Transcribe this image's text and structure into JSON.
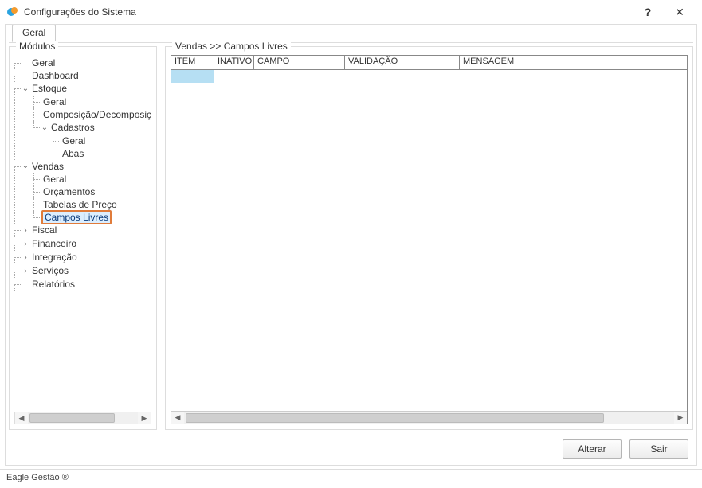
{
  "window": {
    "title": "Configurações do Sistema",
    "help_hint": "?",
    "close_hint": "✕"
  },
  "tabs": {
    "geral": "Geral"
  },
  "sidebar": {
    "legend": "Módulos",
    "items": {
      "geral": "Geral",
      "dashboard": "Dashboard",
      "estoque": "Estoque",
      "estoque_geral": "Geral",
      "estoque_comp": "Composição/Decomposição",
      "estoque_cadastros": "Cadastros",
      "cadastros_geral": "Geral",
      "cadastros_abas": "Abas",
      "vendas": "Vendas",
      "vendas_geral": "Geral",
      "vendas_orcamentos": "Orçamentos",
      "vendas_tabelas": "Tabelas de Preço",
      "vendas_campos_livres": "Campos Livres",
      "fiscal": "Fiscal",
      "financeiro": "Financeiro",
      "integracao": "Integração",
      "servicos": "Serviços",
      "relatorios": "Relatórios"
    }
  },
  "content": {
    "breadcrumb": "Vendas >> Campos Livres",
    "columns": {
      "item": "ITEM",
      "inativo": "INATIVO",
      "campo": "CAMPO",
      "validacao": "VALIDAÇÃO",
      "mensagem": "MENSAGEM"
    }
  },
  "buttons": {
    "alterar": "Alterar",
    "sair": "Sair"
  },
  "status": "Eagle Gestão ®"
}
